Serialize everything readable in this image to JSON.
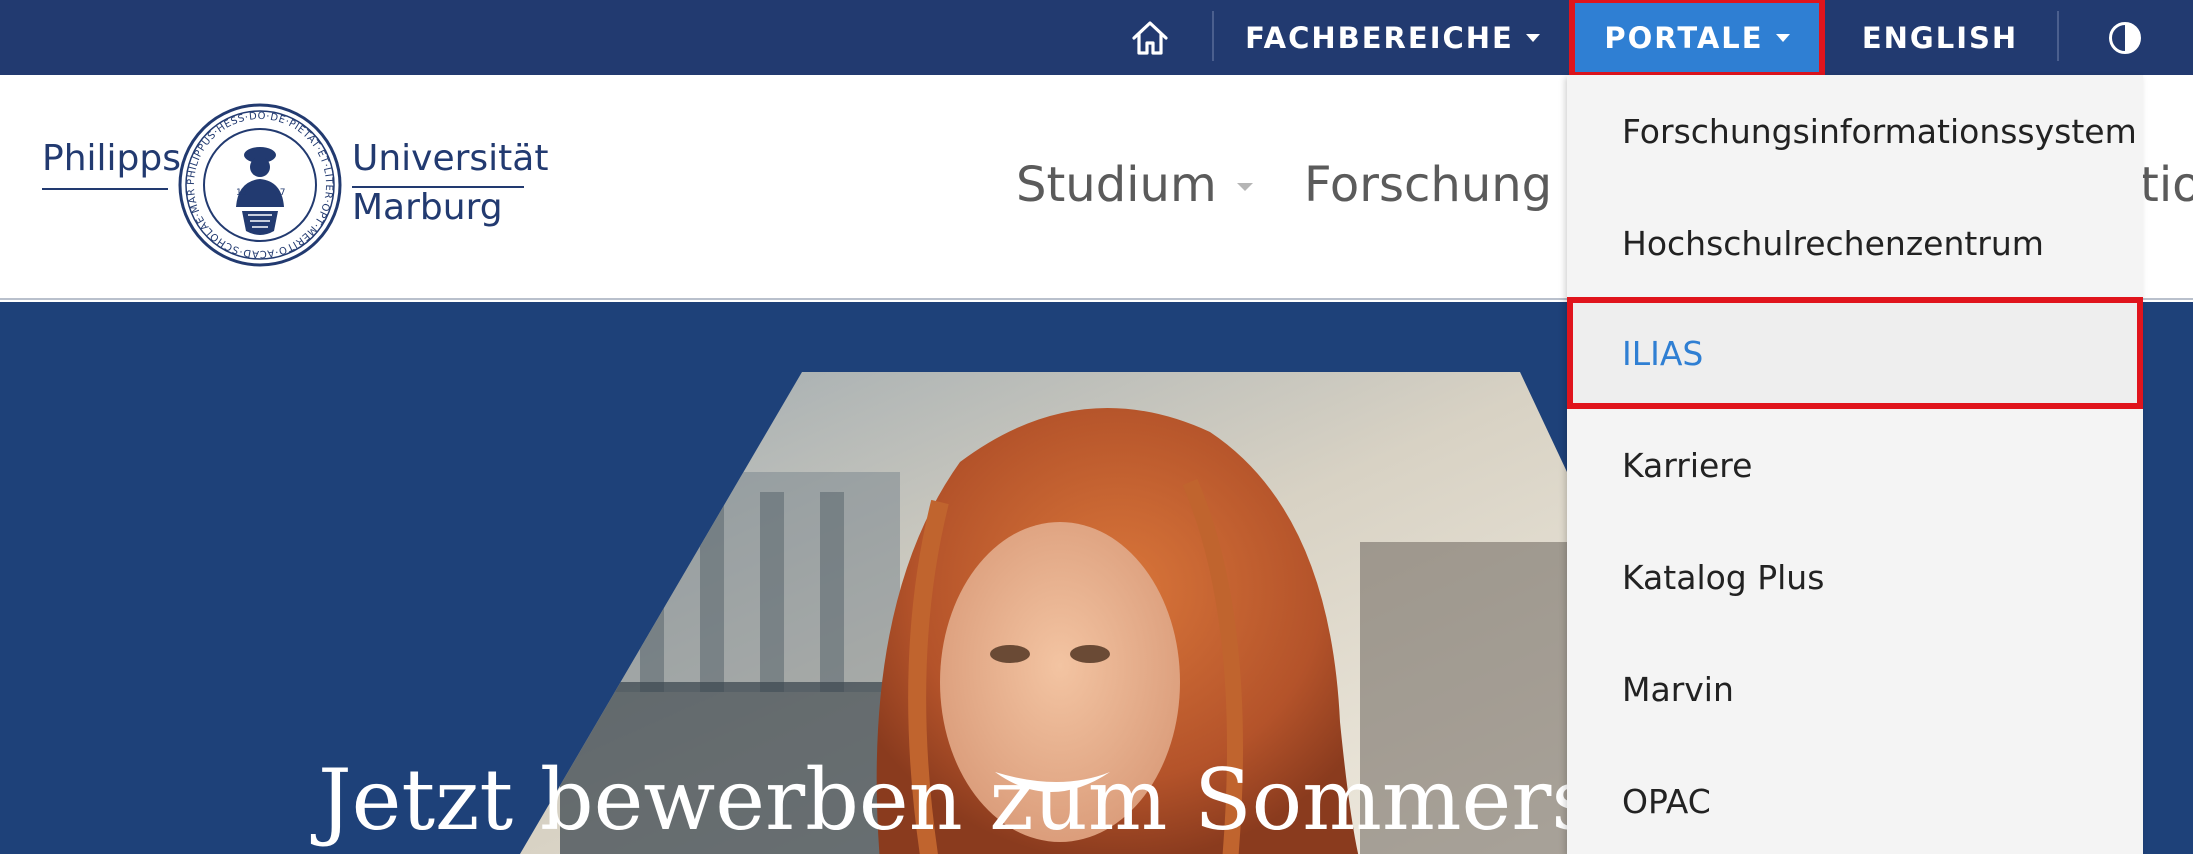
{
  "topbar": {
    "home_icon": "home-icon",
    "fachbereiche_label": "FACHBEREICHE",
    "portale_label": "PORTALE",
    "english_label": "ENGLISH",
    "contrast_icon": "contrast-icon",
    "colors": {
      "bar": "#223a70",
      "active": "#2f7fd3",
      "highlight": "#e0141c"
    }
  },
  "brand": {
    "word_left": "Philipps",
    "word_right_1": "Universität",
    "word_right_2": "Marburg",
    "seal_icon": "university-seal-icon",
    "seal_text": "PHILIPPUS·HESS·DO·DE·PIETAT·ET·LITER·OPT·MERITO·ACAD·SCHOLAE·MARBURGENSIS·AUSP",
    "seal_year_left": "15",
    "seal_year_right": "27"
  },
  "mainnav": {
    "items": [
      {
        "label": "Studium"
      },
      {
        "label": "Forschung"
      },
      {
        "label": "tion"
      }
    ]
  },
  "hero": {
    "title": "Jetzt bewerben zum Sommersem"
  },
  "dropdown": {
    "items": [
      {
        "label": "Forschungsinformationssystem"
      },
      {
        "label": "Hochschulrechenzentrum"
      },
      {
        "label": "ILIAS",
        "active": true
      },
      {
        "label": "Karriere"
      },
      {
        "label": "Katalog Plus"
      },
      {
        "label": "Marvin"
      },
      {
        "label": "OPAC"
      }
    ]
  }
}
